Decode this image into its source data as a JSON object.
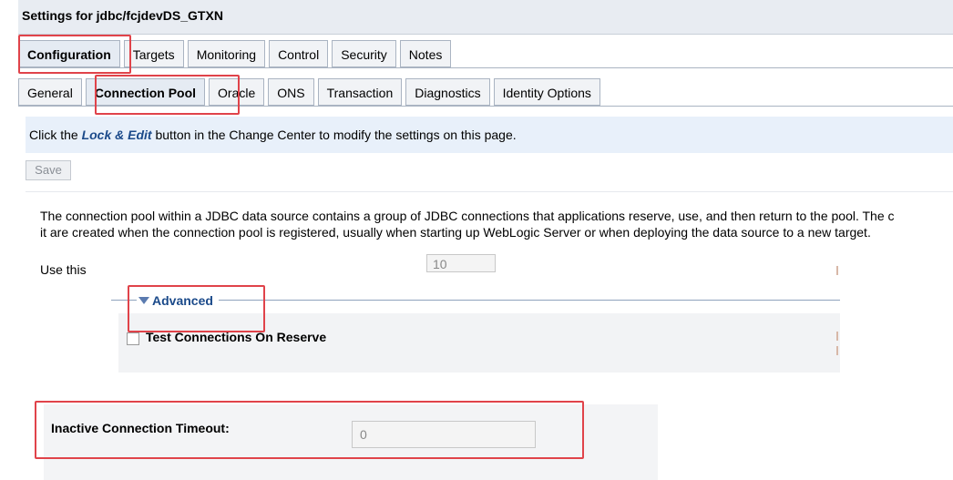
{
  "header": {
    "title": "Settings for jdbc/fcjdevDS_GTXN"
  },
  "tabs_primary": [
    "Configuration",
    "Targets",
    "Monitoring",
    "Control",
    "Security",
    "Notes"
  ],
  "tabs_secondary": [
    "General",
    "Connection Pool",
    "Oracle",
    "ONS",
    "Transaction",
    "Diagnostics",
    "Identity Options"
  ],
  "info": {
    "prefix": "Click the ",
    "lock_edit": "Lock & Edit",
    "suffix": " button in the Change Center to modify the settings on this page."
  },
  "save_label": "Save",
  "description": {
    "line1": "The connection pool within a JDBC data source contains a group of JDBC connections that applications reserve, use, and then return to the pool. The c",
    "line2": "it are created when the connection pool is registered, usually when starting up WebLogic Server or when deploying the data source to a new target.",
    "use_this": "Use this "
  },
  "statement_cache": {
    "value": "10"
  },
  "advanced": {
    "label": "Advanced",
    "test_connections_label": "Test Connections On Reserve",
    "test_connections_checked": false
  },
  "inactive_timeout": {
    "label": "Inactive Connection Timeout:",
    "value": "0"
  },
  "colors": {
    "highlight": "#e0434a",
    "link": "#1b4a8a",
    "info_bg": "#e8f0fa"
  }
}
